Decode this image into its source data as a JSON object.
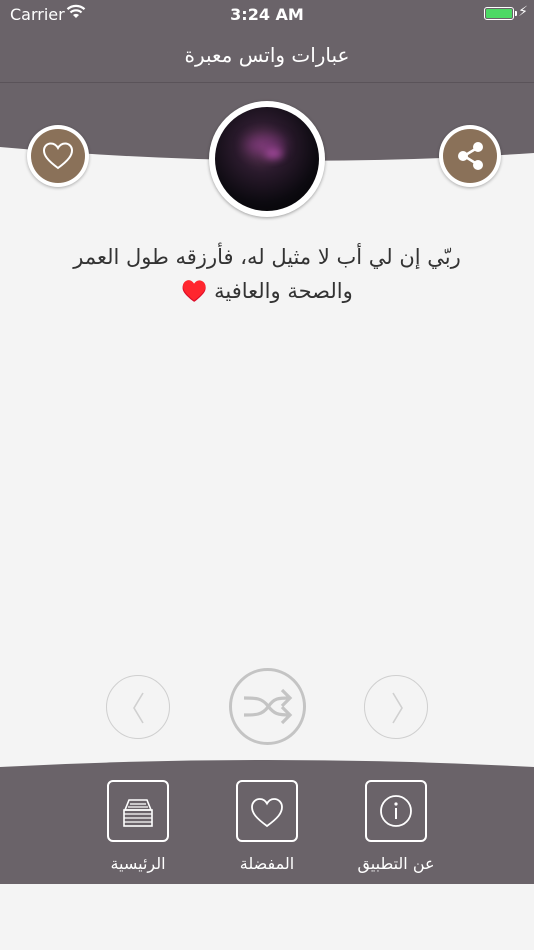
{
  "status_bar": {
    "carrier": "Carrier",
    "time": "3:24 AM",
    "battery_level": 1.0
  },
  "nav": {
    "title": "عبارات واتس معبرة"
  },
  "quote": {
    "text": "ربّي إن لي أب لا مثيل له، فأرزقه طول العمر والصحة والعافية ♥️"
  },
  "actions": {
    "favorite_icon": "heart-outline-icon",
    "share_icon": "share-icon"
  },
  "controls": {
    "previous_icon": "chevron-left-icon",
    "shuffle_icon": "shuffle-icon",
    "next_icon": "chevron-right-icon"
  },
  "tabs": [
    {
      "label": "الرئيسية",
      "icon": "home-stack-icon"
    },
    {
      "label": "المفضلة",
      "icon": "heart-icon"
    },
    {
      "label": "عن التطبيق",
      "icon": "info-icon"
    }
  ],
  "colors": {
    "bar": "#6a6369",
    "accent_brown": "#8a7159",
    "background": "#f4f4f4",
    "battery_green": "#4cd964",
    "heart_red": "#d0101a"
  }
}
